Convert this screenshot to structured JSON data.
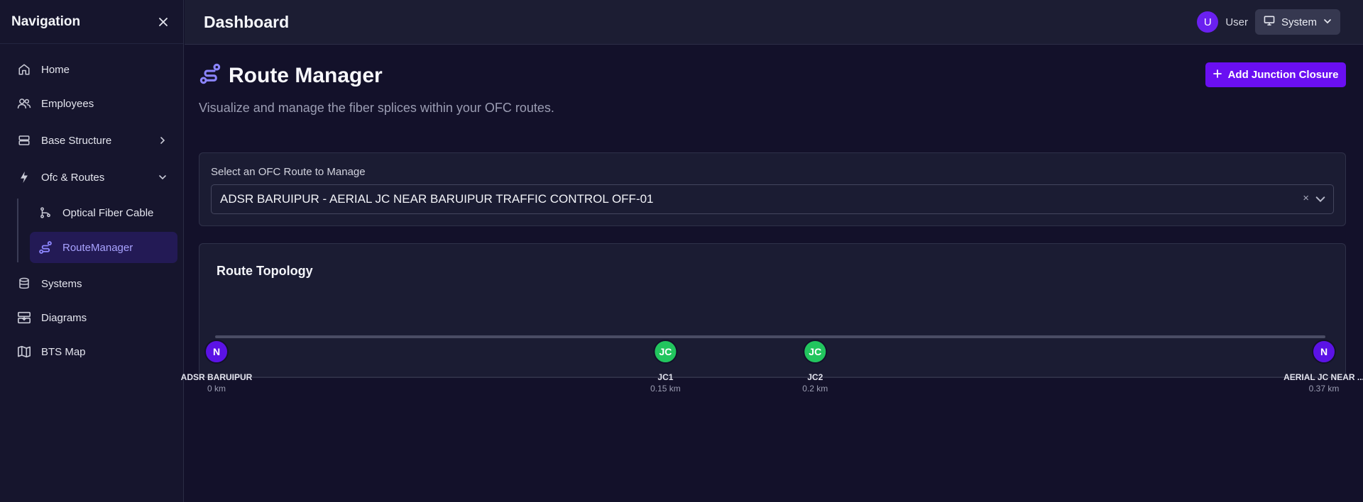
{
  "sidebar": {
    "title": "Navigation",
    "items": [
      {
        "label": "Home",
        "icon": "home-icon"
      },
      {
        "label": "Employees",
        "icon": "users-icon"
      },
      {
        "label": "Base Structure",
        "icon": "layers-icon"
      },
      {
        "label": "Ofc & Routes",
        "icon": "zap-icon"
      },
      {
        "label": "Optical Fiber Cable",
        "icon": "git-branch-icon"
      },
      {
        "label": "RouteManager",
        "icon": "route-icon"
      },
      {
        "label": "Systems",
        "icon": "database-icon"
      },
      {
        "label": "Diagrams",
        "icon": "inbox-icon"
      },
      {
        "label": "BTS Map",
        "icon": "map-icon"
      }
    ]
  },
  "header": {
    "title": "Dashboard",
    "user_initial": "U",
    "user_label": "User",
    "theme_label": "System"
  },
  "main": {
    "title": "Route Manager",
    "subtitle": "Visualize and manage the fiber splices within your OFC routes.",
    "add_button_label": "Add Junction Closure",
    "select_label": "Select an OFC Route to Manage",
    "selected_route": "ADSR BARUIPUR - AERIAL JC NEAR BARUIPUR TRAFFIC CONTROL OFF-01",
    "clear_symbol": "×",
    "topology": {
      "title": "Route Topology",
      "total_km": 0.37,
      "nodes": [
        {
          "badge": "N",
          "name": "ADSR BARUIPUR",
          "distance": "0 km",
          "km": 0,
          "type": "node"
        },
        {
          "badge": "JC",
          "name": "JC1",
          "distance": "0.15 km",
          "km": 0.15,
          "type": "jc"
        },
        {
          "badge": "JC",
          "name": "JC2",
          "distance": "0.2 km",
          "km": 0.2,
          "type": "jc"
        },
        {
          "badge": "N",
          "name": "AERIAL JC NEAR ...",
          "distance": "0.37 km",
          "km": 0.37,
          "type": "node"
        }
      ]
    }
  },
  "colors": {
    "accent": "#6a0ff2",
    "node": "#5b12e6",
    "junction": "#22c55e",
    "active_nav_bg": "#231a55",
    "active_nav_text": "#a8a2ff"
  }
}
